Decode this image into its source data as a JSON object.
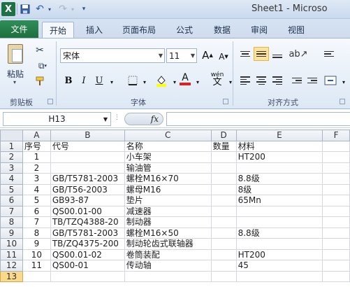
{
  "window": {
    "title": "Sheet1 - Microso",
    "app_icon": "X"
  },
  "quick_access": {
    "save_icon": "save-icon",
    "undo_icon": "undo-icon",
    "redo_icon": "redo-icon"
  },
  "ribbon_tabs": [
    "文件",
    "开始",
    "插入",
    "页面布局",
    "公式",
    "数据",
    "审阅",
    "视图"
  ],
  "active_tab": "开始",
  "clipboard": {
    "paste_label": "粘贴",
    "group_label": "剪贴板"
  },
  "font": {
    "name": "宋体",
    "size": "11",
    "grow": "A",
    "shrink": "A",
    "bold": "B",
    "italic": "I",
    "underline": "U",
    "font_color_letter": "A",
    "phonetic": "wén",
    "group_label": "字体"
  },
  "alignment": {
    "group_label": "对齐方式"
  },
  "formula_bar": {
    "name_box": "H13",
    "fx": "fx",
    "formula": ""
  },
  "columns": [
    "A",
    "B",
    "C",
    "D",
    "E",
    "F"
  ],
  "rows": [
    {
      "n": "1",
      "a": "序号",
      "b": "代号",
      "c": "名称",
      "d": "数量",
      "e": "材料"
    },
    {
      "n": "2",
      "a": "1",
      "b": "",
      "c": "小车架",
      "d": "",
      "e": "HT200"
    },
    {
      "n": "3",
      "a": "2",
      "b": "",
      "c": "输油管",
      "d": "",
      "e": ""
    },
    {
      "n": "4",
      "a": "3",
      "b": "GB/T5781-2003",
      "c": "螺栓M16×70",
      "d": "",
      "e": "8.8级"
    },
    {
      "n": "5",
      "a": "4",
      "b": "GB/T56-2003",
      "c": "螺母M16",
      "d": "",
      "e": "8级"
    },
    {
      "n": "6",
      "a": "5",
      "b": "GB93-87",
      "c": "垫片",
      "d": "",
      "e": "65Mn"
    },
    {
      "n": "7",
      "a": "6",
      "b": "QS00.01-00",
      "c": "减速器",
      "d": "",
      "e": ""
    },
    {
      "n": "8",
      "a": "7",
      "b": "TB/TZQ4388-20",
      "c": "制动器",
      "d": "",
      "e": ""
    },
    {
      "n": "9",
      "a": "8",
      "b": "GB/T5781-2003",
      "c": "螺栓M16×50",
      "d": "",
      "e": "8.8级"
    },
    {
      "n": "10",
      "a": "9",
      "b": "TB/ZQ4375-200",
      "c": "制动轮齿式联轴器",
      "d": "",
      "e": ""
    },
    {
      "n": "11",
      "a": "10",
      "b": "QS00.01-02",
      "c": "卷筒装配",
      "d": "",
      "e": "HT200"
    },
    {
      "n": "12",
      "a": "11",
      "b": "QS00-01",
      "c": "传动轴",
      "d": "",
      "e": "45"
    },
    {
      "n": "13",
      "a": "",
      "b": "",
      "c": "",
      "d": "",
      "e": ""
    }
  ],
  "selected_row": "13",
  "colors": {
    "file_tab": "#1f6f3f",
    "selected_header": "#f9d98b",
    "active_align": "#fbe39a"
  }
}
